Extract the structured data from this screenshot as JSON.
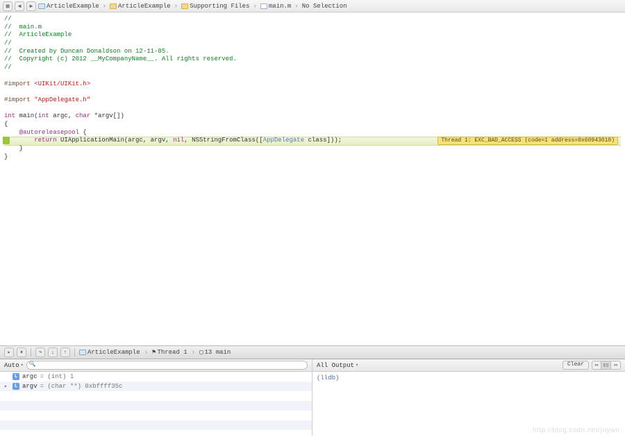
{
  "breadcrumb": {
    "items": [
      {
        "label": "ArticleExample",
        "icon": "proj"
      },
      {
        "label": "ArticleExample",
        "icon": "folder"
      },
      {
        "label": "Supporting Files",
        "icon": "folder"
      },
      {
        "label": "main.m",
        "icon": "file"
      },
      {
        "label": "No Selection",
        "icon": ""
      }
    ]
  },
  "code": {
    "l1": "//",
    "l2": "//  main.m",
    "l3": "//  ArticleExample",
    "l4": "//",
    "l5": "//  Created by Duncan Donaldson on 12-11-05.",
    "l6": "//  Copyright (c) 2012 __MyCompanyName__. All rights reserved.",
    "l7": "//",
    "import1_a": "#import ",
    "import1_b": "<UIKit/UIKit.h>",
    "import2_a": "#import ",
    "import2_b": "\"AppDelegate.h\"",
    "main_a": "int",
    "main_b": " main(",
    "main_c": "int",
    "main_d": " argc, ",
    "main_e": "char",
    "main_f": " *argv[])",
    "brace_open": "{",
    "autorel_a": "    @autoreleasepool",
    "autorel_b": " {",
    "ret_a": "        return",
    "ret_b": " UIApplicationMain(argc, argv, ",
    "ret_c": "nil",
    "ret_d": ", NSStringFromClass([",
    "ret_e": "AppDelegate",
    "ret_f": " class]));",
    "brace_inner": "    }",
    "brace_close": "}"
  },
  "error_badge": "Thread 1: EXC_BAD_ACCESS (code=1 address=0x60943010)",
  "debug_breadcrumb": {
    "items": [
      {
        "label": "ArticleExample"
      },
      {
        "label": "Thread 1"
      },
      {
        "label": "13 main"
      }
    ]
  },
  "vars_pane": {
    "dropdown": "Auto",
    "rows": [
      {
        "disclosure": "",
        "icon": "L",
        "name": "argc",
        "val": "= (int) 1"
      },
      {
        "disclosure": "▸",
        "icon": "L",
        "name": "argv",
        "val": "= (char **) 0xbffff35c"
      }
    ]
  },
  "console_pane": {
    "dropdown": "All Output",
    "clear": "Clear",
    "prompt": "(lldb)"
  },
  "watermark": "http://blog.csdn.net/joywii"
}
